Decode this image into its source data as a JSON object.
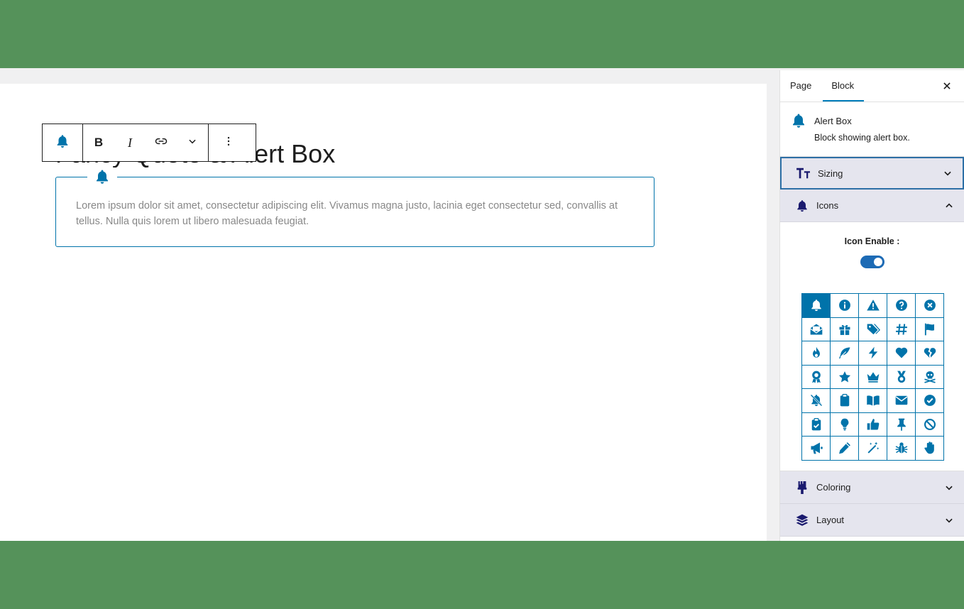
{
  "editor": {
    "title": "Fancy Quote & Alert Box",
    "toolbar": {
      "block_icon": "bell-icon",
      "bold_label": "B",
      "italic_label": "I",
      "link_icon": "link-icon",
      "more_icon": "chevron-down-icon",
      "options_icon": "vertical-ellipsis-icon"
    },
    "alert_box": {
      "icon": "bell-icon",
      "text": "Lorem ipsum dolor sit amet, consectetur adipiscing elit. Vivamus magna justo, lacinia eget consectetur sed, convallis at tellus. Nulla quis lorem ut libero malesuada feugiat."
    }
  },
  "sidebar": {
    "tabs": [
      {
        "label": "Page",
        "active": false
      },
      {
        "label": "Block",
        "active": true
      }
    ],
    "close_icon": "close-icon",
    "block_card": {
      "icon": "bell-icon",
      "name": "Alert Box",
      "description": "Block showing alert box."
    },
    "panels": {
      "sizing": {
        "label": "Sizing",
        "icon": "text-size-icon",
        "expanded": false
      },
      "icons": {
        "label": "Icons",
        "icon": "bell-icon",
        "expanded": true
      },
      "coloring": {
        "label": "Coloring",
        "icon": "paint-brush-icon",
        "expanded": false
      },
      "layout": {
        "label": "Layout",
        "icon": "layers-icon",
        "expanded": false
      }
    },
    "icons_panel": {
      "enable_label": "Icon Enable :",
      "enabled": true,
      "selected_index": 0,
      "icon_names": [
        "bell-icon",
        "info-circle-icon",
        "warning-triangle-icon",
        "question-circle-icon",
        "close-circle-icon",
        "envelope-open-icon",
        "gift-icon",
        "tags-icon",
        "hashtag-icon",
        "flag-icon",
        "fire-icon",
        "feather-icon",
        "bolt-icon",
        "heart-icon",
        "heart-broken-icon",
        "award-icon",
        "star-icon",
        "crown-icon",
        "medal-icon",
        "skull-crossbones-icon",
        "bell-slash-icon",
        "clipboard-icon",
        "book-open-icon",
        "envelope-icon",
        "check-circle-icon",
        "clipboard-check-icon",
        "lightbulb-icon",
        "thumbs-up-icon",
        "thumbtack-icon",
        "ban-icon",
        "bullhorn-icon",
        "pencil-icon",
        "magic-wand-icon",
        "bug-icon",
        "hand-icon"
      ]
    }
  },
  "colors": {
    "accent": "#0073aa",
    "panel_bg": "#e5e5ee",
    "frame_bg": "#55925a",
    "toggle_on": "#1d6bb5"
  }
}
